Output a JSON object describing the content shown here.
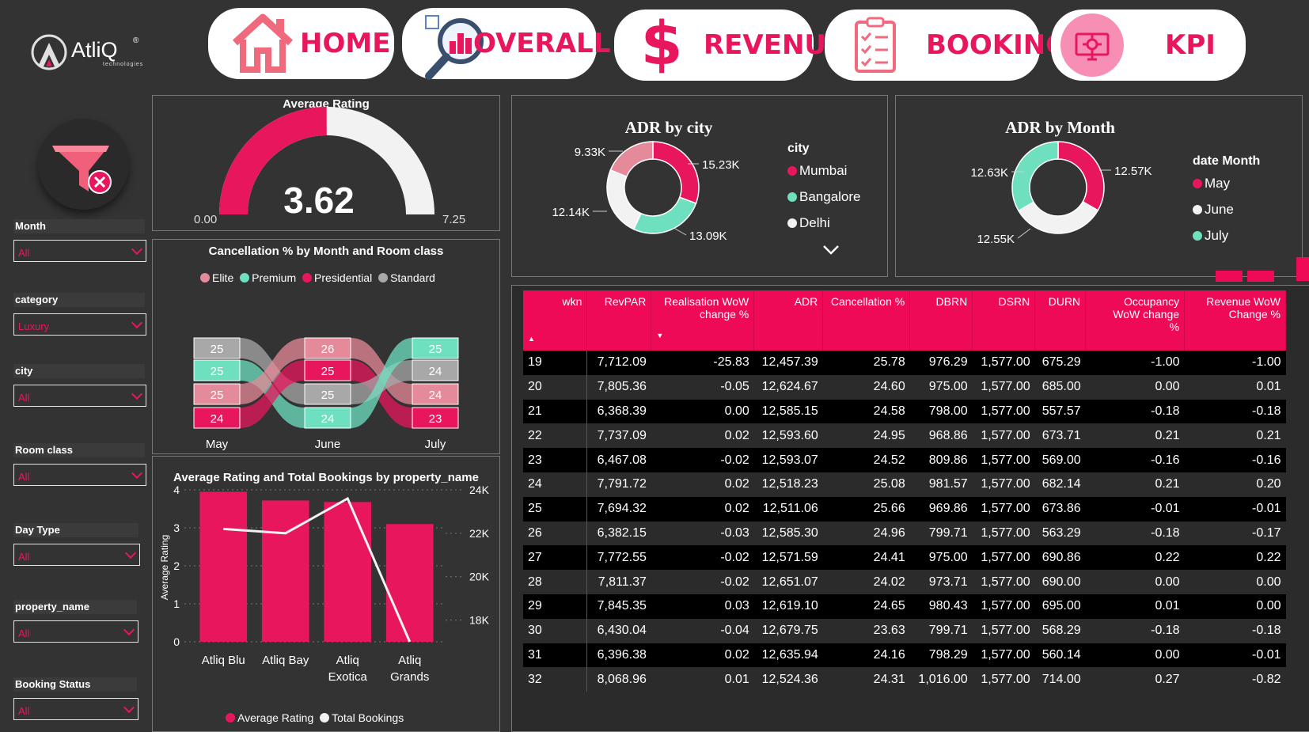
{
  "brand": {
    "name": "AtliQ",
    "reg": "®",
    "tagline": "technologies"
  },
  "nav": [
    {
      "label": "HOME",
      "icon": "house-icon"
    },
    {
      "label": "OVERALL",
      "icon": "magnifier-chart-icon"
    },
    {
      "label": "REVENUE",
      "icon": "dollar-icon"
    },
    {
      "label": "BOOKING",
      "icon": "clipboard-checklist-icon"
    },
    {
      "label": "KPI",
      "icon": "gear-monitor-icon"
    }
  ],
  "filters": [
    {
      "label": "Month",
      "value": "All"
    },
    {
      "label": "category",
      "value": "Luxury"
    },
    {
      "label": "city",
      "value": "All"
    },
    {
      "label": "Room class",
      "value": "All"
    },
    {
      "label": "Day Type",
      "value": "All"
    },
    {
      "label": "property_name",
      "value": "All"
    },
    {
      "label": "Booking Status",
      "value": "All"
    }
  ],
  "colors": {
    "accent": "#ef0a58",
    "pink": "#e8175d",
    "mint": "#6ee0c0",
    "white": "#f2f2f2",
    "rose": "#e58a9a",
    "grey": "#a0a0a0"
  },
  "gauge": {
    "title": "Average Rating",
    "value": "3.62",
    "min": "0.00",
    "max": "7.25",
    "fraction": 0.4993
  },
  "adr_city": {
    "title": "ADR by city",
    "legend_title": "city",
    "legend": [
      "Mumbai",
      "Bangalore",
      "Delhi"
    ],
    "labels": {
      "mumbai": "15.23K",
      "bangalore": "13.09K",
      "delhi": "12.14K",
      "other": "9.33K"
    }
  },
  "adr_month": {
    "title": "ADR by Month",
    "legend_title": "date Month",
    "legend": [
      "May",
      "June",
      "July"
    ],
    "labels": {
      "may": "12.57K",
      "june": "12.55K",
      "july": "12.63K"
    }
  },
  "ribbon": {
    "title": "Cancellation % by Month and Room class",
    "legend": [
      "Elite",
      "Premium",
      "Presidential",
      "Standard"
    ],
    "months": [
      "May",
      "June",
      "July"
    ],
    "cols": [
      [
        "25",
        "25",
        "25",
        "24"
      ],
      [
        "26",
        "25",
        "25",
        "24"
      ],
      [
        "25",
        "24",
        "24",
        "23"
      ]
    ]
  },
  "combo": {
    "title": "Average Rating and Total Bookings by property_name",
    "ylabel": "Average Rating",
    "yticks": [
      "4",
      "3",
      "2",
      "1",
      "0"
    ],
    "y2ticks": [
      "24K",
      "22K",
      "20K",
      "18K"
    ],
    "legend": [
      "Average Rating",
      "Total Bookings"
    ]
  },
  "chart_data": {
    "type": "bar",
    "title": "Average Rating and Total Bookings by property_name",
    "categories": [
      "Atliq Blu",
      "Atliq Bay",
      "Atliq Exotica",
      "Atliq Grands"
    ],
    "category_lines": [
      [
        "Atliq Blu"
      ],
      [
        "Atliq Bay"
      ],
      [
        "Atliq",
        "Exotica"
      ],
      [
        "Atliq",
        "Grands"
      ]
    ],
    "ylabel": "Average Rating",
    "ylim": [
      0,
      4
    ],
    "y2lim": [
      17000,
      24000
    ],
    "series": [
      {
        "name": "Average Rating",
        "values": [
          3.95,
          3.72,
          3.68,
          3.1
        ],
        "kind": "bar"
      },
      {
        "name": "Total Bookings",
        "values": [
          22200,
          22000,
          23600,
          17000
        ],
        "kind": "line"
      }
    ]
  },
  "table": {
    "headers": [
      [
        "wkn"
      ],
      [
        "RevPAR"
      ],
      [
        "Realisation WoW",
        "change %"
      ],
      [
        "ADR"
      ],
      [
        "Cancellation %"
      ],
      [
        "DBRN"
      ],
      [
        "DSRN"
      ],
      [
        "DURN"
      ],
      [
        "Occupancy",
        "WoW change",
        "%"
      ],
      [
        "Revenue WoW",
        "Change %"
      ]
    ],
    "rows": [
      [
        "19",
        "7,712.09",
        "-25.83",
        "12,457.39",
        "25.78",
        "976.29",
        "1,577.00",
        "675.29",
        "-1.00",
        "-1.00"
      ],
      [
        "20",
        "7,805.36",
        "-0.05",
        "12,624.67",
        "24.60",
        "975.00",
        "1,577.00",
        "685.00",
        "0.00",
        "0.01"
      ],
      [
        "21",
        "6,368.39",
        "0.00",
        "12,585.15",
        "24.58",
        "798.00",
        "1,577.00",
        "557.57",
        "-0.18",
        "-0.18"
      ],
      [
        "22",
        "7,737.09",
        "0.02",
        "12,593.60",
        "24.95",
        "968.86",
        "1,577.00",
        "673.71",
        "0.21",
        "0.21"
      ],
      [
        "23",
        "6,467.08",
        "-0.02",
        "12,593.07",
        "24.52",
        "809.86",
        "1,577.00",
        "569.00",
        "-0.16",
        "-0.16"
      ],
      [
        "24",
        "7,791.72",
        "0.02",
        "12,518.23",
        "25.08",
        "981.57",
        "1,577.00",
        "682.14",
        "0.21",
        "0.20"
      ],
      [
        "25",
        "7,694.32",
        "0.02",
        "12,511.06",
        "25.66",
        "969.86",
        "1,577.00",
        "673.86",
        "-0.01",
        "-0.01"
      ],
      [
        "26",
        "6,382.15",
        "-0.03",
        "12,585.30",
        "24.96",
        "799.71",
        "1,577.00",
        "563.29",
        "-0.18",
        "-0.17"
      ],
      [
        "27",
        "7,772.55",
        "-0.02",
        "12,571.59",
        "24.41",
        "975.00",
        "1,577.00",
        "690.86",
        "0.22",
        "0.22"
      ],
      [
        "28",
        "7,811.37",
        "-0.02",
        "12,651.07",
        "24.02",
        "973.71",
        "1,577.00",
        "690.00",
        "0.00",
        "0.00"
      ],
      [
        "29",
        "7,845.35",
        "0.03",
        "12,619.10",
        "24.65",
        "980.43",
        "1,577.00",
        "695.00",
        "0.01",
        "0.00"
      ],
      [
        "30",
        "6,430.04",
        "-0.04",
        "12,679.75",
        "23.63",
        "799.71",
        "1,577.00",
        "568.29",
        "-0.18",
        "-0.18"
      ],
      [
        "31",
        "6,396.38",
        "0.02",
        "12,635.94",
        "24.16",
        "798.29",
        "1,577.00",
        "560.14",
        "0.00",
        "-0.01"
      ],
      [
        "32",
        "8,068.96",
        "0.01",
        "12,524.36",
        "24.31",
        "1,016.00",
        "1,577.00",
        "714.00",
        "0.27",
        "-0.82"
      ]
    ]
  }
}
